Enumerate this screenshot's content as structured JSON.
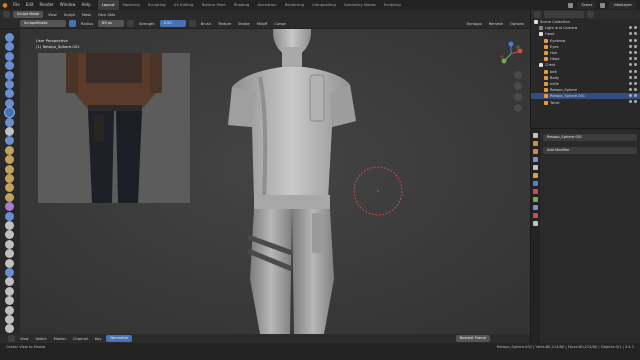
{
  "topbar": {
    "menus": [
      "File",
      "Edit",
      "Render",
      "Window",
      "Help"
    ],
    "workspaces": [
      "Layout",
      "Modeling",
      "Sculpting",
      "UV Editing",
      "Texture Paint",
      "Shading",
      "Animation",
      "Rendering",
      "Compositing",
      "Geometry Nodes",
      "Scripting"
    ],
    "active_workspace": "Layout",
    "scene_label": "Scene",
    "viewlayer_label": "ViewLayer"
  },
  "header": {
    "mode": "Sculpt Mode",
    "view_menus": [
      "View",
      "Sculpt",
      "Mask",
      "Face Sets"
    ],
    "brush_name": "ScrapeMasks",
    "radius_label": "Radius",
    "radius_value": "89 px",
    "strength_label": "Strength",
    "strength_value": "0.50",
    "brush_menu": "Brush",
    "texture_menu": "Texture",
    "stroke_menu": "Stroke",
    "falloff_menu": "Falloff",
    "cursor_menu": "Cursor",
    "dyntopo": "Dyntopo",
    "remesh": "Remesh",
    "options": "Options"
  },
  "viewport": {
    "perspective": "User Perspective",
    "object": "(1) Retopo_Sphere.001"
  },
  "outliner": {
    "root": "Scene Collection",
    "items": [
      {
        "label": "Light and Camera",
        "depth": 1,
        "color": "#888888"
      },
      {
        "label": "Head",
        "depth": 1,
        "color": "#dddddd"
      },
      {
        "label": "Eyebrow",
        "depth": 2,
        "color": "#e89a3c"
      },
      {
        "label": "Eyes",
        "depth": 2,
        "color": "#e89a3c"
      },
      {
        "label": "Hair",
        "depth": 2,
        "color": "#e89a3c"
      },
      {
        "label": "Head",
        "depth": 2,
        "color": "#e89a3c"
      },
      {
        "label": "Chest",
        "depth": 1,
        "color": "#dddddd"
      },
      {
        "label": "belt",
        "depth": 2,
        "color": "#e89a3c"
      },
      {
        "label": "Body",
        "depth": 2,
        "color": "#e89a3c"
      },
      {
        "label": "knife",
        "depth": 2,
        "color": "#e89a3c"
      },
      {
        "label": "Retopo_Sphere",
        "depth": 2,
        "color": "#e89a3c"
      },
      {
        "label": "Retopo_Sphere.001",
        "depth": 2,
        "color": "#e89a3c",
        "selected": true
      },
      {
        "label": "Tshirt",
        "depth": 2,
        "color": "#e89a3c"
      }
    ]
  },
  "properties": {
    "object_name": "Retopo_Sphere.001",
    "add_modifier": "Add Modifier"
  },
  "bottombar": {
    "items": [
      "View",
      "Select",
      "Marker",
      "Channel",
      "Key"
    ],
    "playback": "Normalize",
    "keyframe": "Nearest Frame"
  },
  "status": {
    "left": "Center View to Mouse",
    "right": "Retopo_Sphere.001 | Verts:80,214/80 | Faces:80,214/80 | Objects:0/1 | 3.4.1"
  },
  "colors": {
    "accent": "#4772b3",
    "logo": "#e87d0d",
    "brush_circle": "#e05050"
  }
}
